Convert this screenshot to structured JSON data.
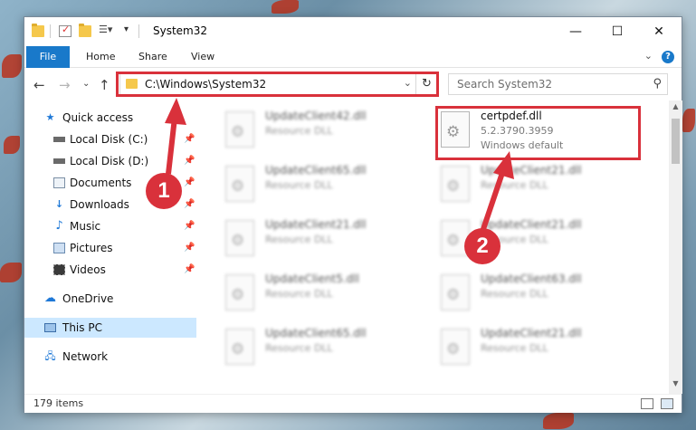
{
  "window": {
    "title": "System32",
    "controls": {
      "minimize": "—",
      "maximize": "☐",
      "close": "✕"
    }
  },
  "ribbon": {
    "tabs": [
      "File",
      "Home",
      "Share",
      "View"
    ],
    "help_icon": "?"
  },
  "nav": {
    "address": "C:\\Windows\\System32",
    "search_placeholder": "Search System32"
  },
  "sidebar": {
    "items": [
      {
        "label": "Quick access",
        "icon": "star-icon",
        "pinned": false
      },
      {
        "label": "Local Disk (C:)",
        "icon": "drive-icon",
        "pinned": true
      },
      {
        "label": "Local Disk (D:)",
        "icon": "drive-icon",
        "pinned": true
      },
      {
        "label": "Documents",
        "icon": "documents-icon",
        "pinned": true
      },
      {
        "label": "Downloads",
        "icon": "download-icon",
        "pinned": true
      },
      {
        "label": "Music",
        "icon": "music-icon",
        "pinned": true
      },
      {
        "label": "Pictures",
        "icon": "pictures-icon",
        "pinned": true
      },
      {
        "label": "Videos",
        "icon": "videos-icon",
        "pinned": true
      },
      {
        "label": "OneDrive",
        "icon": "cloud-icon",
        "pinned": false
      },
      {
        "label": "This PC",
        "icon": "computer-icon",
        "pinned": false,
        "selected": true
      },
      {
        "label": "Network",
        "icon": "network-icon",
        "pinned": false
      }
    ]
  },
  "files": {
    "left": [
      {
        "name": "UpdateClient42.dll",
        "type": "Resource DLL"
      },
      {
        "name": "UpdateClient65.dll",
        "type": "Resource DLL"
      },
      {
        "name": "UpdateClient21.dll",
        "type": "Resource DLL"
      },
      {
        "name": "UpdateClient5.dll",
        "type": "Resource DLL"
      },
      {
        "name": "UpdateClient65.dll",
        "type": "Resource DLL"
      }
    ],
    "right": [
      {
        "name": "UpdateClient21.dll",
        "type": "Resource DLL"
      },
      {
        "name": "UpdateClient21.dll",
        "type": "Resource DLL"
      },
      {
        "name": "UpdateClient63.dll",
        "type": "Resource DLL"
      },
      {
        "name": "UpdateClient21.dll",
        "type": "Resource DLL"
      }
    ],
    "highlighted": {
      "name": "certpdef.dll",
      "version": "5.2.3790.3959",
      "description": "Windows default"
    }
  },
  "status": {
    "item_count": "179 items"
  },
  "annotations": {
    "badge_1": "1",
    "badge_2": "2",
    "color": "#d9313b"
  }
}
